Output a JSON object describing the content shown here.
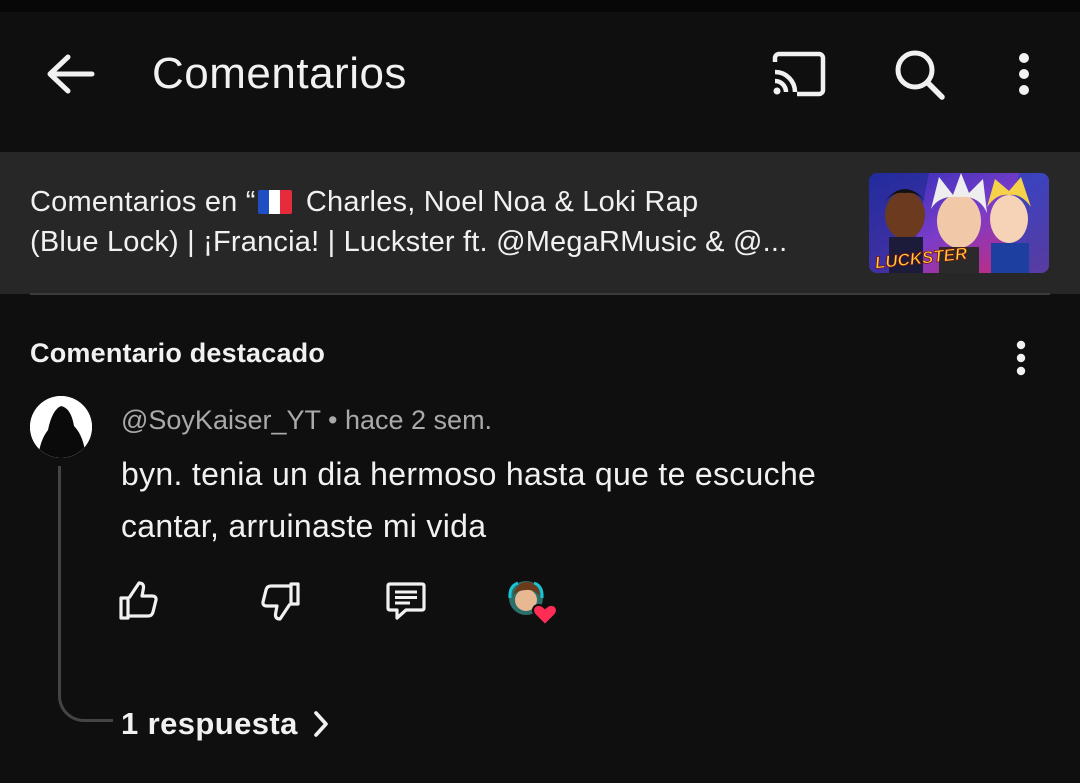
{
  "appbar": {
    "title": "Comentarios",
    "icons": [
      "back-arrow-icon",
      "cast-icon",
      "search-icon",
      "more-vert-icon"
    ]
  },
  "video_banner": {
    "prefix": "Comentarios en “",
    "flag": "🇫🇷",
    "title_line1": " Charles, Noel Noa & Loki Rap",
    "title_line2": "(Blue Lock) | ¡Francia! | Luckster ft. @MegaRMusic & @...",
    "thumbnail_text": "LUCKSTER"
  },
  "featured": {
    "section_label": "Comentario destacado",
    "author": "@SoyKaiser_YT",
    "separator": "•",
    "time": "hace 2 sem.",
    "text_line1": "byn. tenia un dia hermoso hasta que te escuche",
    "text_line2": "cantar, arruinaste mi vida",
    "actions": [
      "thumb-up-icon",
      "thumb-down-icon",
      "reply-comment-icon",
      "creator-heart-icon"
    ],
    "replies_label": "1 respuesta"
  },
  "colors": {
    "background": "#0f0f0f",
    "banner": "#272727",
    "text_primary": "#f1f1f1",
    "text_secondary": "#aaaaaa",
    "heart": "#ff2d55"
  }
}
